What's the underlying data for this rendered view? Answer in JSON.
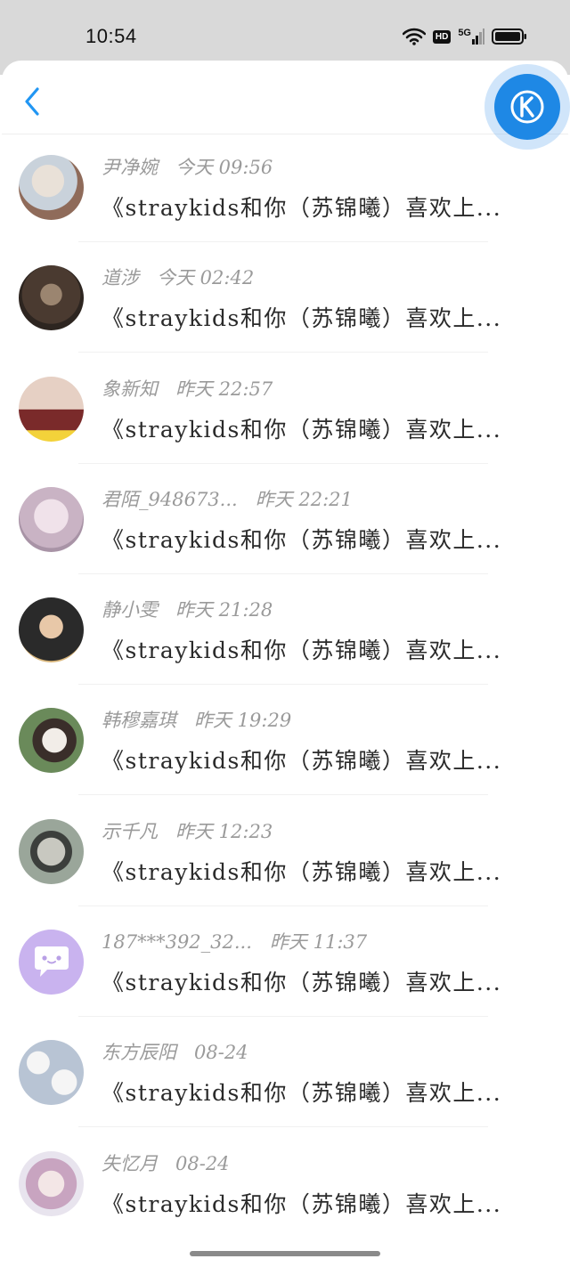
{
  "status_bar": {
    "time": "10:54",
    "network_label": "5G",
    "hd_label": "HD"
  },
  "nav": {
    "back_icon": "chevron-left-icon",
    "floating_icon": "k-circle-icon",
    "accent": "#1e88e5"
  },
  "chats": [
    {
      "name": "尹净婉",
      "time": "今天 09:56",
      "preview": "《straykids和你（苏锦曦）喜欢上...",
      "avatar_colors": [
        "#c9d2db",
        "#8f6b5a"
      ]
    },
    {
      "name": "道涉",
      "time": "今天 02:42",
      "preview": "《straykids和你（苏锦曦）喜欢上...",
      "avatar_colors": [
        "#4a3a30",
        "#9b8570"
      ]
    },
    {
      "name": "象新知",
      "time": "昨天 22:57",
      "preview": "《straykids和你（苏锦曦）喜欢上...",
      "avatar_colors": [
        "#e6d0c4",
        "#7a2a2a"
      ]
    },
    {
      "name": "君陌_948673...",
      "time": "昨天 22:21",
      "preview": "《straykids和你（苏锦曦）喜欢上...",
      "avatar_colors": [
        "#f0e2ea",
        "#c9b3c4"
      ]
    },
    {
      "name": "静小雯",
      "time": "昨天 21:28",
      "preview": "《straykids和你（苏锦曦）喜欢上...",
      "avatar_colors": [
        "#2a2a2a",
        "#d8b57a"
      ]
    },
    {
      "name": "韩穆嘉琪",
      "time": "昨天 19:29",
      "preview": "《straykids和你（苏锦曦）喜欢上...",
      "avatar_colors": [
        "#6a8a5a",
        "#f2ede8"
      ]
    },
    {
      "name": "示千凡",
      "time": "昨天 12:23",
      "preview": "《straykids和你（苏锦曦）喜欢上...",
      "avatar_colors": [
        "#9aa69a",
        "#3c3f3c"
      ]
    },
    {
      "name": "187***392_32...",
      "time": "昨天 11:37",
      "preview": "《straykids和你（苏锦曦）喜欢上...",
      "avatar_colors": [
        "#c9b3ef",
        "#ffffff"
      ]
    },
    {
      "name": "东方辰阳",
      "time": "08-24",
      "preview": "《straykids和你（苏锦曦）喜欢上...",
      "avatar_colors": [
        "#b8c4d4",
        "#f5f5f5"
      ]
    },
    {
      "name": "失忆月",
      "time": "08-24",
      "preview": "《straykids和你（苏锦曦）喜欢上...",
      "avatar_colors": [
        "#e8e4ee",
        "#c8a4c0"
      ]
    }
  ]
}
